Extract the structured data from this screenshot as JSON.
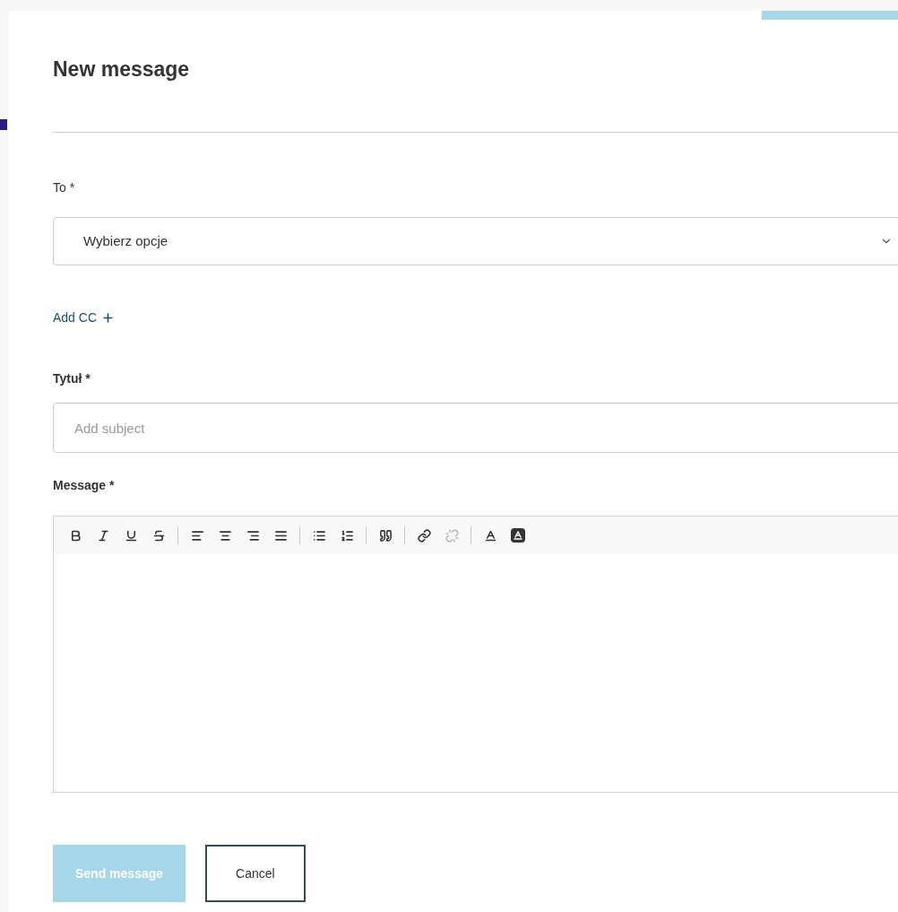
{
  "dialog": {
    "title": "New message"
  },
  "to": {
    "label": "To *",
    "value": "Wybierz opcje"
  },
  "add_cc": {
    "label": "Add CC"
  },
  "subject": {
    "label": "Tytuł *",
    "placeholder": "Add subject"
  },
  "message": {
    "label": "Message *",
    "toolbar": [
      {
        "kind": "bold",
        "disabled": false
      },
      {
        "kind": "italic",
        "disabled": false
      },
      {
        "kind": "underline",
        "disabled": false
      },
      {
        "kind": "strike",
        "disabled": false
      },
      {
        "kind": "separator"
      },
      {
        "kind": "align-left",
        "disabled": false
      },
      {
        "kind": "align-center",
        "disabled": false
      },
      {
        "kind": "align-right",
        "disabled": false
      },
      {
        "kind": "align-justify",
        "disabled": false
      },
      {
        "kind": "separator"
      },
      {
        "kind": "bullet-list",
        "disabled": false
      },
      {
        "kind": "numbered-list",
        "disabled": false
      },
      {
        "kind": "separator"
      },
      {
        "kind": "quote",
        "disabled": false
      },
      {
        "kind": "separator"
      },
      {
        "kind": "link",
        "disabled": false
      },
      {
        "kind": "unlink",
        "disabled": true
      },
      {
        "kind": "separator"
      },
      {
        "kind": "text-color",
        "disabled": false
      },
      {
        "kind": "background-color",
        "disabled": false
      }
    ]
  },
  "buttons": [
    {
      "label": "Send message",
      "kind": "primary",
      "disabled": true
    },
    {
      "label": "Cancel",
      "kind": "secondary",
      "disabled": false
    }
  ]
}
